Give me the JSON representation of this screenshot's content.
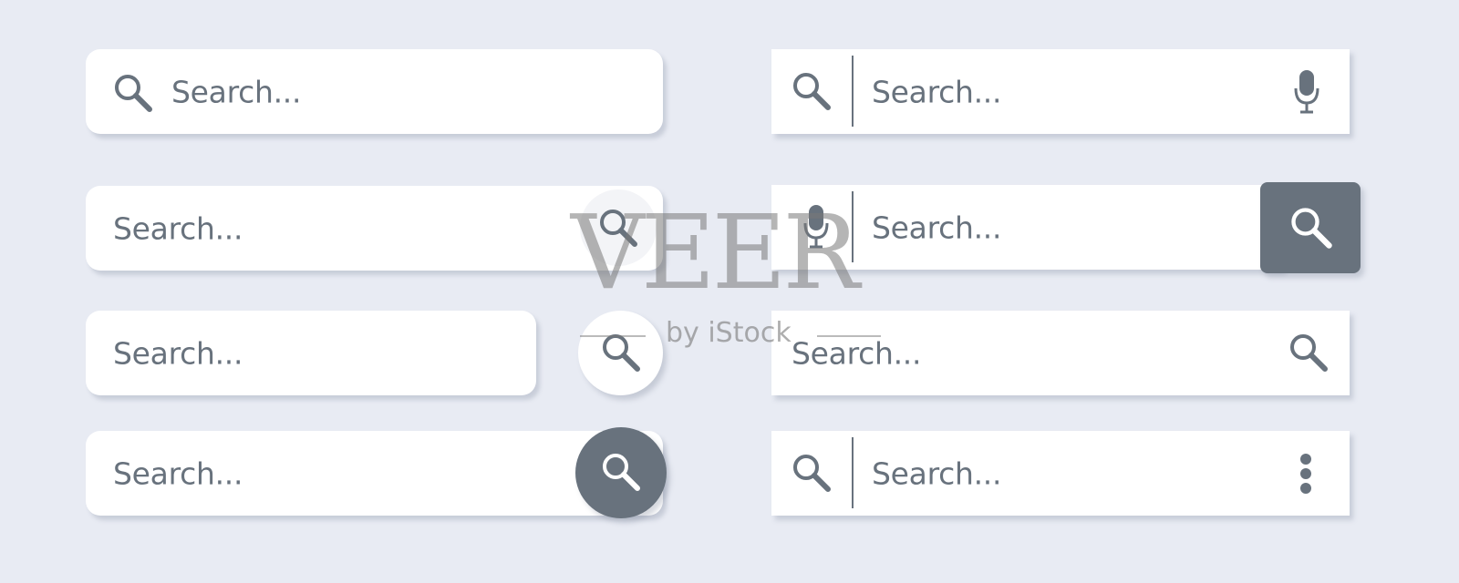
{
  "placeholder": "Search...",
  "colors": {
    "background": "#e8ebf3",
    "field": "#ffffff",
    "icon": "#68727d",
    "button_dark": "#68727d",
    "button_light": "#ffffff"
  },
  "search_bars": [
    {
      "style": "rounded",
      "left_icon": "search-icon",
      "right_icon": null
    },
    {
      "style": "rounded",
      "left_icon": null,
      "right_icon": "search-icon",
      "right_button": "light-circle"
    },
    {
      "style": "rounded",
      "left_icon": null,
      "right_icon": "search-icon",
      "right_button": "separate-light-circle"
    },
    {
      "style": "rounded",
      "left_icon": null,
      "right_icon": "search-icon",
      "right_button": "dark-circle"
    },
    {
      "style": "square",
      "left_icon": "search-icon",
      "divider": true,
      "right_icon": "microphone-icon"
    },
    {
      "style": "square",
      "left_icon": "microphone-icon",
      "divider": true,
      "right_icon": "search-icon",
      "right_button": "dark-square"
    },
    {
      "style": "square",
      "left_icon": null,
      "right_icon": "search-icon"
    },
    {
      "style": "square",
      "left_icon": "search-icon",
      "divider": true,
      "right_icon": "more-vertical-icon"
    }
  ],
  "watermark": {
    "title": "VEER",
    "subtitle": "by iStock"
  }
}
